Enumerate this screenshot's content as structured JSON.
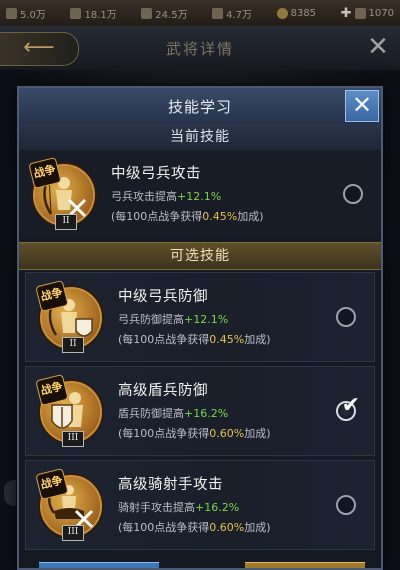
{
  "resources": [
    {
      "icon": "troops-icon",
      "value": "5.0万"
    },
    {
      "icon": "wood-icon",
      "value": "18.1万"
    },
    {
      "icon": "stone-icon",
      "value": "24.5万"
    },
    {
      "icon": "iron-icon",
      "value": "4.7万"
    },
    {
      "icon": "gold-icon",
      "value": "8385"
    },
    {
      "icon": "ingot-icon",
      "value": "1070"
    }
  ],
  "background": {
    "page_title": "武将详情"
  },
  "modal": {
    "title": "技能学习",
    "close_glyph": "✕",
    "current_section_label": "当前技能",
    "optional_section_label": "可选技能"
  },
  "current_skill": {
    "name": "中级弓兵攻击",
    "badge": "战争",
    "rank": "II",
    "effect_prefix": "弓兵攻击提高",
    "effect_value": "+12.1%",
    "gain_prefix": "(每100点战争获得",
    "gain_value": "0.45%",
    "gain_suffix": "加成)",
    "selected": false
  },
  "optional_skills": [
    {
      "name": "中级弓兵防御",
      "badge": "战争",
      "rank": "II",
      "effect_prefix": "弓兵防御提高",
      "effect_value": "+12.1%",
      "gain_prefix": "(每100点战争获得",
      "gain_value": "0.45%",
      "gain_suffix": "加成)",
      "selected": false
    },
    {
      "name": "高级盾兵防御",
      "badge": "战争",
      "rank": "III",
      "effect_prefix": "盾兵防御提高",
      "effect_value": "+16.2%",
      "gain_prefix": "(每100点战争获得",
      "gain_value": "0.60%",
      "gain_suffix": "加成)",
      "selected": true
    },
    {
      "name": "高级骑射手攻击",
      "badge": "战争",
      "rank": "III",
      "effect_prefix": "骑射手攻击提高",
      "effect_value": "+16.2%",
      "gain_prefix": "(每100点战争获得",
      "gain_value": "0.60%",
      "gain_suffix": "加成)",
      "selected": false
    }
  ],
  "colors": {
    "effect_value": "#79d64a",
    "gain_value": "#e5c14c",
    "modal_title_bar": "#394b67",
    "optional_header": "#5f4f2a"
  }
}
